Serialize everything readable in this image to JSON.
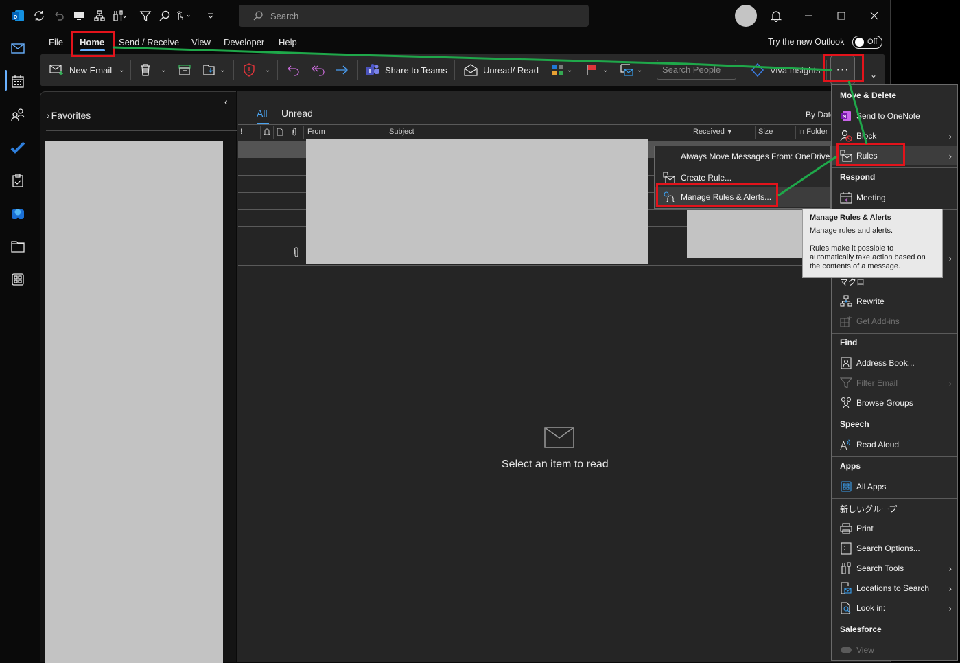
{
  "titlebar": {
    "search_placeholder": "Search",
    "quick_access_icons": [
      "outlook-logo-icon",
      "sync-icon",
      "undo-icon",
      "monitor-icon",
      "org-chart-icon",
      "search-tools-icon",
      "filter-icon",
      "search-icon",
      "touch-mode-icon",
      "customize-icon"
    ],
    "window_controls": [
      "minimize",
      "maximize",
      "close"
    ]
  },
  "menu_tabs": [
    "File",
    "Home",
    "Send / Receive",
    "View",
    "Developer",
    "Help"
  ],
  "active_tab": "Home",
  "try_new_outlook": {
    "label": "Try the new Outlook",
    "toggle_state": "Off"
  },
  "ribbon": {
    "new_email": "New Email",
    "share_to_teams": "Share to Teams",
    "unread_read": "Unread/ Read",
    "search_people_placeholder": "Search People",
    "viva_insights": "Viva Insights",
    "more_label": "···"
  },
  "rail": [
    "mail",
    "calendar",
    "people",
    "todo",
    "tasks",
    "apps-m365",
    "files",
    "more-apps"
  ],
  "folder_pane": {
    "favorites": "Favorites"
  },
  "message_list": {
    "filters": [
      "All",
      "Unread"
    ],
    "active_filter": "All",
    "sort": "By Date",
    "columns": [
      "!",
      "",
      "",
      "",
      "From",
      "Subject",
      "Received",
      "Size",
      "In Folder"
    ],
    "empty_message": "Select an item to read"
  },
  "overflow_menu": {
    "sections": [
      {
        "header": "Move & Delete",
        "items": [
          {
            "label": "Send to OneNote",
            "submenu": false,
            "disabled": false
          },
          {
            "label": "Block",
            "submenu": true,
            "disabled": false
          },
          {
            "label": "Rules",
            "submenu": true,
            "disabled": false,
            "highlighted": true
          }
        ]
      },
      {
        "header": "Respond",
        "items": [
          {
            "label": "Meeting",
            "submenu": false,
            "disabled": false
          }
        ]
      },
      {
        "header": "マクロ",
        "items": [
          {
            "label": "Rewrite",
            "submenu": false,
            "disabled": false
          },
          {
            "label": "Get Add-ins",
            "submenu": false,
            "disabled": true
          }
        ]
      },
      {
        "header": "Find",
        "items": [
          {
            "label": "Address Book...",
            "submenu": false,
            "disabled": false
          },
          {
            "label": "Filter Email",
            "submenu": true,
            "disabled": true
          },
          {
            "label": "Browse Groups",
            "submenu": false,
            "disabled": false
          }
        ]
      },
      {
        "header": "Speech",
        "items": [
          {
            "label": "Read Aloud",
            "submenu": false,
            "disabled": false
          }
        ]
      },
      {
        "header": "Apps",
        "items": [
          {
            "label": "All Apps",
            "submenu": false,
            "disabled": false
          }
        ]
      },
      {
        "header": "新しいグループ",
        "items": [
          {
            "label": "Print",
            "submenu": false,
            "disabled": false
          },
          {
            "label": "Search Options...",
            "submenu": false,
            "disabled": false
          },
          {
            "label": "Search Tools",
            "submenu": true,
            "disabled": false
          },
          {
            "label": "Locations to Search",
            "submenu": true,
            "disabled": false
          },
          {
            "label": "Look in:",
            "submenu": true,
            "disabled": false
          }
        ]
      },
      {
        "header": "Salesforce",
        "items": [
          {
            "label": "View",
            "submenu": false,
            "disabled": true
          }
        ]
      }
    ]
  },
  "rules_submenu": {
    "items": [
      "Always Move Messages From: OneDrive",
      "Create Rule...",
      "Manage Rules & Alerts..."
    ],
    "highlighted": "Manage Rules & Alerts..."
  },
  "tooltip": {
    "title": "Manage Rules & Alerts",
    "line1": "Manage rules and alerts.",
    "line2": "Rules make it possible to automatically take action based on the contents of a message."
  },
  "annotation_colors": {
    "highlight_box": "#e3131b",
    "path_line": "#1fa84a"
  }
}
